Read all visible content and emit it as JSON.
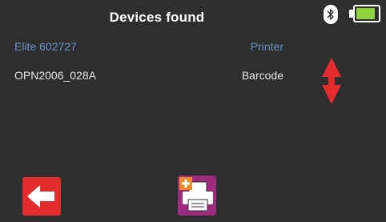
{
  "header": {
    "title": "Devices found",
    "bluetooth_icon": "bluetooth-icon",
    "battery_level": 0.9
  },
  "devices": [
    {
      "name": "Elite 602727",
      "type": "Printer",
      "selected": true
    },
    {
      "name": "OPN2006_028A",
      "type": "Barcode",
      "selected": false
    }
  ],
  "controls": {
    "scroll_icon": "up-down-arrows-icon",
    "back_icon": "back-arrow-icon",
    "print_icon": "add-printer-icon"
  },
  "colors": {
    "background": "#2e2e2e",
    "selected_text": "#6b8fc4",
    "normal_text": "#e6e6e6",
    "accent_red": "#e32c2c",
    "battery_green": "#8fd23f",
    "print_button": "#9d2c7e"
  }
}
